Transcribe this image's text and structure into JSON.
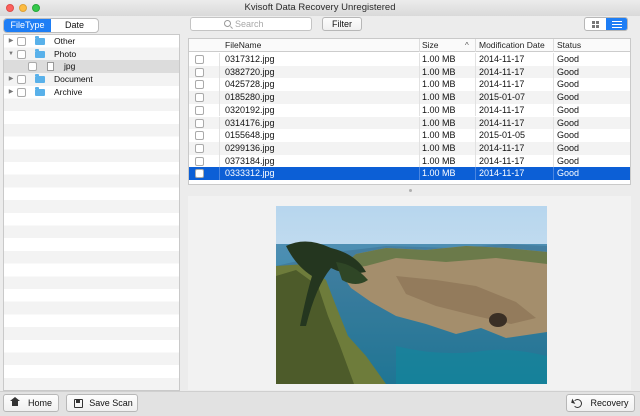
{
  "window": {
    "title": "Kvisoft Data Recovery Unregistered"
  },
  "left": {
    "tabs": [
      {
        "label": "FileType",
        "active": true
      },
      {
        "label": "Date",
        "active": false
      }
    ],
    "tree": [
      {
        "label": "Other",
        "expanded": false,
        "icon": "folder-icon"
      },
      {
        "label": "Photo",
        "expanded": true,
        "icon": "folder-icon"
      },
      {
        "label": "jpg",
        "child": true,
        "icon": "file-icon",
        "selected": true
      },
      {
        "label": "Document",
        "expanded": false,
        "icon": "folder-icon"
      },
      {
        "label": "Archive",
        "expanded": false,
        "icon": "folder-icon"
      }
    ]
  },
  "toolbar": {
    "search_placeholder": "Search",
    "filter_label": "Filter",
    "view_modes": [
      "grid",
      "list"
    ],
    "active_view": "list"
  },
  "table": {
    "columns": [
      "FileName",
      "Size",
      "Modification Date",
      "Status"
    ],
    "sort_column": "Size",
    "rows": [
      {
        "name": "0317312.jpg",
        "size": "1.00 MB",
        "date": "2014-11-17",
        "status": "Good"
      },
      {
        "name": "0382720.jpg",
        "size": "1.00 MB",
        "date": "2014-11-17",
        "status": "Good"
      },
      {
        "name": "0425728.jpg",
        "size": "1.00 MB",
        "date": "2014-11-17",
        "status": "Good"
      },
      {
        "name": "0185280.jpg",
        "size": "1.00 MB",
        "date": "2015-01-07",
        "status": "Good"
      },
      {
        "name": "0320192.jpg",
        "size": "1.00 MB",
        "date": "2014-11-17",
        "status": "Good"
      },
      {
        "name": "0314176.jpg",
        "size": "1.00 MB",
        "date": "2014-11-17",
        "status": "Good"
      },
      {
        "name": "0155648.jpg",
        "size": "1.00 MB",
        "date": "2015-01-05",
        "status": "Good"
      },
      {
        "name": "0299136.jpg",
        "size": "1.00 MB",
        "date": "2014-11-17",
        "status": "Good"
      },
      {
        "name": "0373184.jpg",
        "size": "1.00 MB",
        "date": "2014-11-17",
        "status": "Good"
      },
      {
        "name": "0333312.jpg",
        "size": "1.00 MB",
        "date": "2014-11-17",
        "status": "Good",
        "selected": true
      }
    ]
  },
  "bottom": {
    "home_label": "Home",
    "save_scan_label": "Save Scan",
    "recovery_label": "Recovery"
  },
  "colors": {
    "accent": "#1e7ef5",
    "selection": "#0c5fd6"
  }
}
